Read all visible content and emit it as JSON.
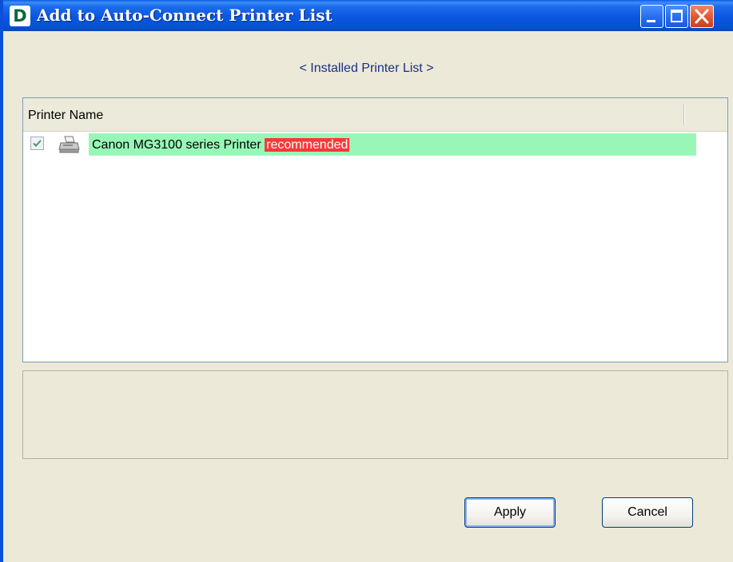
{
  "window": {
    "title": "Add to Auto-Connect Printer List",
    "app_icon_letter": "D",
    "controls": [
      "minimize-icon",
      "maximize-icon",
      "close-icon"
    ]
  },
  "subtitle": "< Installed Printer List >",
  "list": {
    "columns": [
      "Printer Name"
    ],
    "rows": [
      {
        "checked": true,
        "icon": "printer-icon",
        "name": "Canon MG3100 series Printer",
        "badge": "recommended"
      }
    ]
  },
  "buttons": {
    "apply": "Apply",
    "cancel": "Cancel"
  },
  "colors": {
    "titlebar": "#0a56e0",
    "row_highlight": "#98f7b7",
    "badge_bg": "#fb3838",
    "subtitle_text": "#1a2f8a"
  }
}
